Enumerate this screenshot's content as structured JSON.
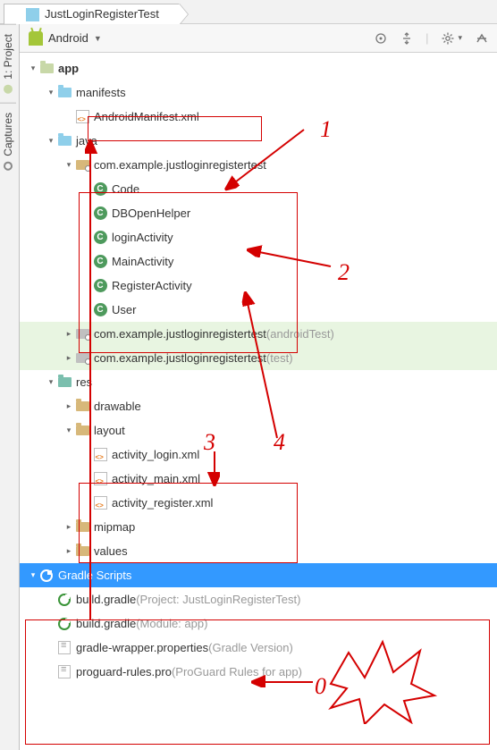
{
  "breadcrumb": {
    "project": "JustLoginRegisterTest"
  },
  "toolbar": {
    "view": "Android"
  },
  "sidebar": {
    "project": "1: Project",
    "captures": "Captures"
  },
  "tree": {
    "app": "app",
    "manifests": "manifests",
    "manifest_file": "AndroidManifest.xml",
    "java": "java",
    "pkg_main": "com.example.justloginregistertest",
    "classes": [
      "Code",
      "DBOpenHelper",
      "loginActivity",
      "MainActivity",
      "RegisterActivity",
      "User"
    ],
    "pkg_at": "com.example.justloginregistertest",
    "pkg_at_suffix": " (androidTest)",
    "pkg_test": "com.example.justloginregistertest",
    "pkg_test_suffix": " (test)",
    "res": "res",
    "drawable": "drawable",
    "layout": "layout",
    "layouts": [
      "activity_login.xml",
      "activity_main.xml",
      "activity_register.xml"
    ],
    "mipmap": "mipmap",
    "values": "values",
    "gradle_scripts": "Gradle Scripts",
    "bg_project": "build.gradle",
    "bg_project_suffix": " (Project: JustLoginRegisterTest)",
    "bg_module": "build.gradle",
    "bg_module_suffix": " (Module: app)",
    "gw": "gradle-wrapper.properties",
    "gw_suffix": " (Gradle Version)",
    "pg": "proguard-rules.pro",
    "pg_suffix": " (ProGuard Rules for app)"
  },
  "annotations": {
    "n0": "0",
    "n1": "1",
    "n2": "2",
    "n3": "3",
    "n4": "4"
  }
}
